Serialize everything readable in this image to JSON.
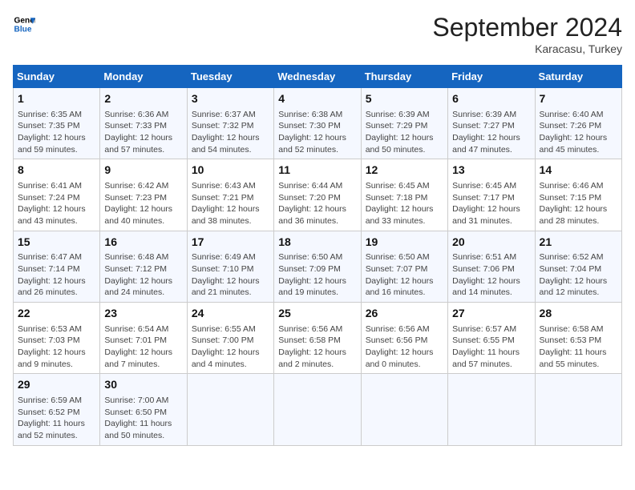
{
  "header": {
    "logo_line1": "General",
    "logo_line2": "Blue",
    "month": "September 2024",
    "location": "Karacasu, Turkey"
  },
  "weekdays": [
    "Sunday",
    "Monday",
    "Tuesday",
    "Wednesday",
    "Thursday",
    "Friday",
    "Saturday"
  ],
  "weeks": [
    [
      {
        "day": 1,
        "lines": [
          "Sunrise: 6:35 AM",
          "Sunset: 7:35 PM",
          "Daylight: 12 hours",
          "and 59 minutes."
        ]
      },
      {
        "day": 2,
        "lines": [
          "Sunrise: 6:36 AM",
          "Sunset: 7:33 PM",
          "Daylight: 12 hours",
          "and 57 minutes."
        ]
      },
      {
        "day": 3,
        "lines": [
          "Sunrise: 6:37 AM",
          "Sunset: 7:32 PM",
          "Daylight: 12 hours",
          "and 54 minutes."
        ]
      },
      {
        "day": 4,
        "lines": [
          "Sunrise: 6:38 AM",
          "Sunset: 7:30 PM",
          "Daylight: 12 hours",
          "and 52 minutes."
        ]
      },
      {
        "day": 5,
        "lines": [
          "Sunrise: 6:39 AM",
          "Sunset: 7:29 PM",
          "Daylight: 12 hours",
          "and 50 minutes."
        ]
      },
      {
        "day": 6,
        "lines": [
          "Sunrise: 6:39 AM",
          "Sunset: 7:27 PM",
          "Daylight: 12 hours",
          "and 47 minutes."
        ]
      },
      {
        "day": 7,
        "lines": [
          "Sunrise: 6:40 AM",
          "Sunset: 7:26 PM",
          "Daylight: 12 hours",
          "and 45 minutes."
        ]
      }
    ],
    [
      {
        "day": 8,
        "lines": [
          "Sunrise: 6:41 AM",
          "Sunset: 7:24 PM",
          "Daylight: 12 hours",
          "and 43 minutes."
        ]
      },
      {
        "day": 9,
        "lines": [
          "Sunrise: 6:42 AM",
          "Sunset: 7:23 PM",
          "Daylight: 12 hours",
          "and 40 minutes."
        ]
      },
      {
        "day": 10,
        "lines": [
          "Sunrise: 6:43 AM",
          "Sunset: 7:21 PM",
          "Daylight: 12 hours",
          "and 38 minutes."
        ]
      },
      {
        "day": 11,
        "lines": [
          "Sunrise: 6:44 AM",
          "Sunset: 7:20 PM",
          "Daylight: 12 hours",
          "and 36 minutes."
        ]
      },
      {
        "day": 12,
        "lines": [
          "Sunrise: 6:45 AM",
          "Sunset: 7:18 PM",
          "Daylight: 12 hours",
          "and 33 minutes."
        ]
      },
      {
        "day": 13,
        "lines": [
          "Sunrise: 6:45 AM",
          "Sunset: 7:17 PM",
          "Daylight: 12 hours",
          "and 31 minutes."
        ]
      },
      {
        "day": 14,
        "lines": [
          "Sunrise: 6:46 AM",
          "Sunset: 7:15 PM",
          "Daylight: 12 hours",
          "and 28 minutes."
        ]
      }
    ],
    [
      {
        "day": 15,
        "lines": [
          "Sunrise: 6:47 AM",
          "Sunset: 7:14 PM",
          "Daylight: 12 hours",
          "and 26 minutes."
        ]
      },
      {
        "day": 16,
        "lines": [
          "Sunrise: 6:48 AM",
          "Sunset: 7:12 PM",
          "Daylight: 12 hours",
          "and 24 minutes."
        ]
      },
      {
        "day": 17,
        "lines": [
          "Sunrise: 6:49 AM",
          "Sunset: 7:10 PM",
          "Daylight: 12 hours",
          "and 21 minutes."
        ]
      },
      {
        "day": 18,
        "lines": [
          "Sunrise: 6:50 AM",
          "Sunset: 7:09 PM",
          "Daylight: 12 hours",
          "and 19 minutes."
        ]
      },
      {
        "day": 19,
        "lines": [
          "Sunrise: 6:50 AM",
          "Sunset: 7:07 PM",
          "Daylight: 12 hours",
          "and 16 minutes."
        ]
      },
      {
        "day": 20,
        "lines": [
          "Sunrise: 6:51 AM",
          "Sunset: 7:06 PM",
          "Daylight: 12 hours",
          "and 14 minutes."
        ]
      },
      {
        "day": 21,
        "lines": [
          "Sunrise: 6:52 AM",
          "Sunset: 7:04 PM",
          "Daylight: 12 hours",
          "and 12 minutes."
        ]
      }
    ],
    [
      {
        "day": 22,
        "lines": [
          "Sunrise: 6:53 AM",
          "Sunset: 7:03 PM",
          "Daylight: 12 hours",
          "and 9 minutes."
        ]
      },
      {
        "day": 23,
        "lines": [
          "Sunrise: 6:54 AM",
          "Sunset: 7:01 PM",
          "Daylight: 12 hours",
          "and 7 minutes."
        ]
      },
      {
        "day": 24,
        "lines": [
          "Sunrise: 6:55 AM",
          "Sunset: 7:00 PM",
          "Daylight: 12 hours",
          "and 4 minutes."
        ]
      },
      {
        "day": 25,
        "lines": [
          "Sunrise: 6:56 AM",
          "Sunset: 6:58 PM",
          "Daylight: 12 hours",
          "and 2 minutes."
        ]
      },
      {
        "day": 26,
        "lines": [
          "Sunrise: 6:56 AM",
          "Sunset: 6:56 PM",
          "Daylight: 12 hours",
          "and 0 minutes."
        ]
      },
      {
        "day": 27,
        "lines": [
          "Sunrise: 6:57 AM",
          "Sunset: 6:55 PM",
          "Daylight: 11 hours",
          "and 57 minutes."
        ]
      },
      {
        "day": 28,
        "lines": [
          "Sunrise: 6:58 AM",
          "Sunset: 6:53 PM",
          "Daylight: 11 hours",
          "and 55 minutes."
        ]
      }
    ],
    [
      {
        "day": 29,
        "lines": [
          "Sunrise: 6:59 AM",
          "Sunset: 6:52 PM",
          "Daylight: 11 hours",
          "and 52 minutes."
        ]
      },
      {
        "day": 30,
        "lines": [
          "Sunrise: 7:00 AM",
          "Sunset: 6:50 PM",
          "Daylight: 11 hours",
          "and 50 minutes."
        ]
      },
      null,
      null,
      null,
      null,
      null
    ]
  ]
}
